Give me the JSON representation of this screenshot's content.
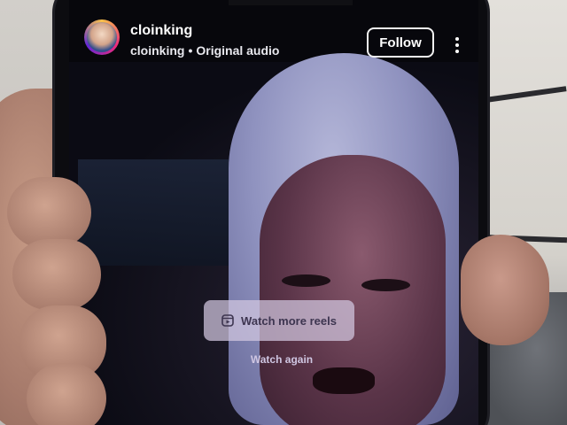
{
  "reel": {
    "username": "cloinking",
    "audio_owner": "cloinking",
    "audio_separator": "•",
    "audio_title": "Original audio",
    "follow_label": "Follow",
    "more_icon": "more-vertical-icon"
  },
  "overlay": {
    "watch_more_label": "Watch more reels",
    "watch_more_icon": "reels-icon",
    "watch_again_label": "Watch again"
  },
  "colors": {
    "overlay_button_bg": "#d2c8e1",
    "overlay_text": "#3d3550",
    "follow_border": "#f2f2f2"
  }
}
